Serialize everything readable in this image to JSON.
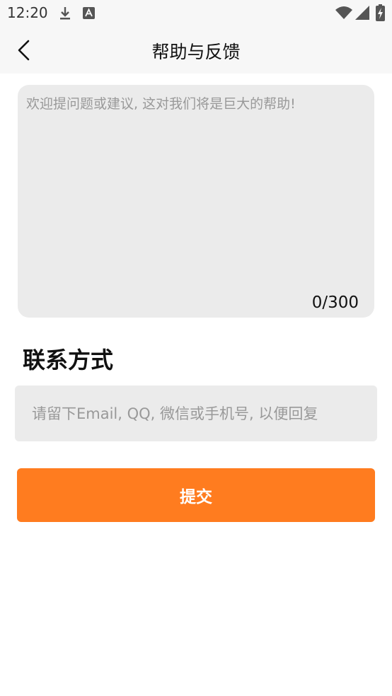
{
  "status_bar": {
    "time": "12:20",
    "icons": [
      "download-icon",
      "font-a-icon",
      "wifi-icon",
      "signal-icon",
      "battery-charging-icon"
    ]
  },
  "app_bar": {
    "title": "帮助与反馈",
    "back_icon": "chevron-left-icon"
  },
  "feedback": {
    "placeholder": "欢迎提问题或建议, 这对我们将是巨大的帮助!",
    "value": "",
    "counter": "0/300"
  },
  "contact": {
    "section_title": "联系方式",
    "placeholder": "请留下Email, QQ, 微信或手机号, 以便回复",
    "value": ""
  },
  "submit": {
    "label": "提交"
  },
  "colors": {
    "accent": "#ff7c1f",
    "field_bg": "#ebebeb",
    "bar_bg": "#f7f7f7"
  }
}
